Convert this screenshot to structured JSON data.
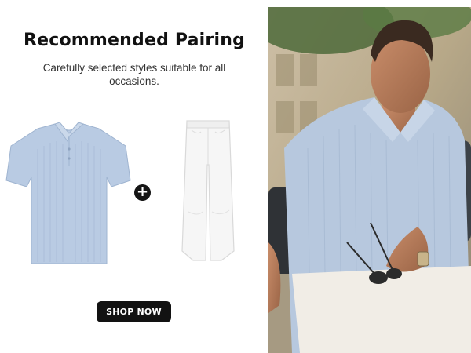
{
  "banner": {
    "title": "Recommended Pairing",
    "subtitle": "Carefully selected styles suitable for all occasions.",
    "cta_label": "SHOP NOW",
    "plus_glyph": "+"
  },
  "products": [
    {
      "name": "polo-shirt",
      "color": "#b9cbe3"
    },
    {
      "name": "white-pants",
      "color": "#f4f4f4"
    }
  ],
  "icons": {
    "plus": "plus-icon"
  },
  "colors": {
    "accent": "#121212",
    "shirt": "#b9cbe3"
  }
}
